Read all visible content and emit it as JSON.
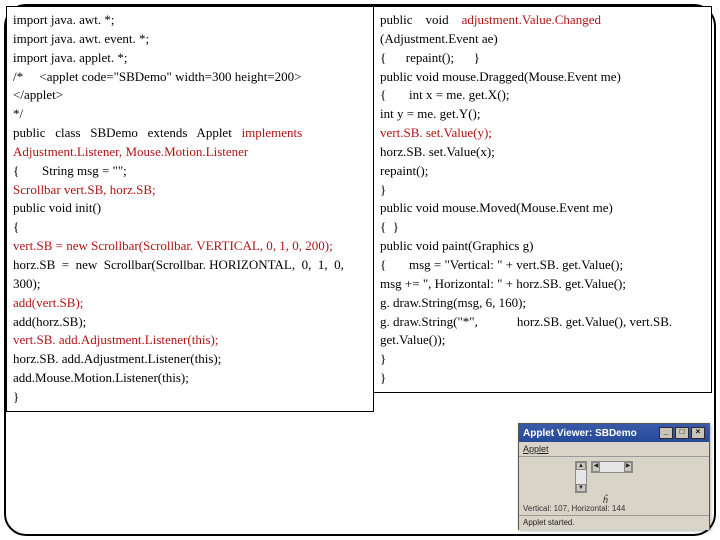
{
  "code": {
    "col1": [
      {
        "segments": [
          {
            "t": "import java. awt. *;",
            "c": "black"
          }
        ]
      },
      {
        "segments": [
          {
            "t": "import java. awt. event. *;",
            "c": "black"
          }
        ]
      },
      {
        "segments": [
          {
            "t": "import java. applet. *;",
            "c": "black"
          }
        ]
      },
      {
        "segments": [
          {
            "t": "/*     <applet code=\"SBDemo\" width=300 height=200>",
            "c": "black"
          }
        ]
      },
      {
        "segments": [
          {
            "t": "</applet>",
            "c": "black"
          }
        ]
      },
      {
        "segments": [
          {
            "t": "*/",
            "c": "black"
          }
        ]
      },
      {
        "segments": [
          {
            "t": "public   class   SBDemo   extends   Applet   ",
            "c": "black"
          },
          {
            "t": "implements",
            "c": "red"
          }
        ]
      },
      {
        "segments": [
          {
            "t": "Adjustment.Listener, Mouse.Motion.Listener",
            "c": "red"
          }
        ]
      },
      {
        "segments": [
          {
            "t": "{       String msg = \"\";",
            "c": "black"
          }
        ]
      },
      {
        "segments": [
          {
            "t": "Scrollbar vert.SB, horz.SB;",
            "c": "red"
          }
        ]
      },
      {
        "segments": [
          {
            "t": "public void init()",
            "c": "black"
          }
        ]
      },
      {
        "segments": [
          {
            "t": "{",
            "c": "black"
          }
        ]
      },
      {
        "segments": [
          {
            "t": "vert.SB = new Scrollbar(Scrollbar. VERTICAL, 0, 1, 0, 200);",
            "c": "red"
          }
        ]
      },
      {
        "segments": [
          {
            "t": "horz.SB  =  new  Scrollbar(Scrollbar. HORIZONTAL,  0,  1,  0, 300);",
            "c": "black"
          }
        ]
      },
      {
        "segments": [
          {
            "t": "add(vert.SB);",
            "c": "red"
          }
        ]
      },
      {
        "segments": [
          {
            "t": "add(horz.SB);",
            "c": "black"
          }
        ]
      },
      {
        "segments": [
          {
            "t": "vert.SB. add.Adjustment.Listener(this);",
            "c": "red"
          }
        ]
      },
      {
        "segments": [
          {
            "t": "horz.SB. add.Adjustment.Listener(this);",
            "c": "black"
          }
        ]
      },
      {
        "segments": [
          {
            "t": "add.Mouse.Motion.Listener(this);",
            "c": "black"
          }
        ]
      },
      {
        "segments": [
          {
            "t": "}",
            "c": "black"
          }
        ]
      }
    ],
    "col2": [
      {
        "segments": [
          {
            "t": "public    void    ",
            "c": "black"
          },
          {
            "t": "adjustment.Value.Changed",
            "c": "red"
          }
        ]
      },
      {
        "segments": [
          {
            "t": "(Adjustment.Event ae)",
            "c": "black"
          }
        ]
      },
      {
        "segments": [
          {
            "t": "{      repaint();      }",
            "c": "black"
          }
        ]
      },
      {
        "segments": [
          {
            "t": "public void mouse.Dragged(Mouse.Event me)",
            "c": "black"
          }
        ]
      },
      {
        "segments": [
          {
            "t": "{       int x = me. get.X();",
            "c": "black"
          }
        ]
      },
      {
        "segments": [
          {
            "t": "int y = me. get.Y();",
            "c": "black"
          }
        ]
      },
      {
        "segments": [
          {
            "t": "vert.SB. set.Value(y);",
            "c": "red"
          }
        ]
      },
      {
        "segments": [
          {
            "t": "horz.SB. set.Value(x);",
            "c": "black"
          }
        ]
      },
      {
        "segments": [
          {
            "t": "repaint();",
            "c": "black"
          }
        ]
      },
      {
        "segments": [
          {
            "t": "}",
            "c": "black"
          }
        ]
      },
      {
        "segments": [
          {
            "t": "public void mouse.Moved(Mouse.Event me)",
            "c": "black"
          }
        ]
      },
      {
        "segments": [
          {
            "t": "{  }",
            "c": "black"
          }
        ]
      },
      {
        "segments": [
          {
            "t": "public void paint(Graphics g)",
            "c": "black"
          }
        ]
      },
      {
        "segments": [
          {
            "t": "{       msg = \"Vertical: \" + vert.SB. get.Value();",
            "c": "black"
          }
        ]
      },
      {
        "segments": [
          {
            "t": "msg += \", Horizontal: \" + horz.SB. get.Value();",
            "c": "black"
          }
        ]
      },
      {
        "segments": [
          {
            "t": "g. draw.String(msg, 6, 160);",
            "c": "black"
          }
        ]
      },
      {
        "segments": [
          {
            "t": "g. draw.String(\"*\",            horz.SB. get.Value(), vert.SB. get.Value());",
            "c": "black"
          }
        ]
      },
      {
        "segments": [
          {
            "t": "}",
            "c": "black"
          }
        ]
      },
      {
        "segments": [
          {
            "t": "}",
            "c": "black"
          }
        ]
      }
    ]
  },
  "applet": {
    "titlebar": "Applet Viewer: SBDemo",
    "menu": "Applet",
    "values": "Vertical: 107,  Horizontal: 144",
    "status": "Applet started."
  }
}
